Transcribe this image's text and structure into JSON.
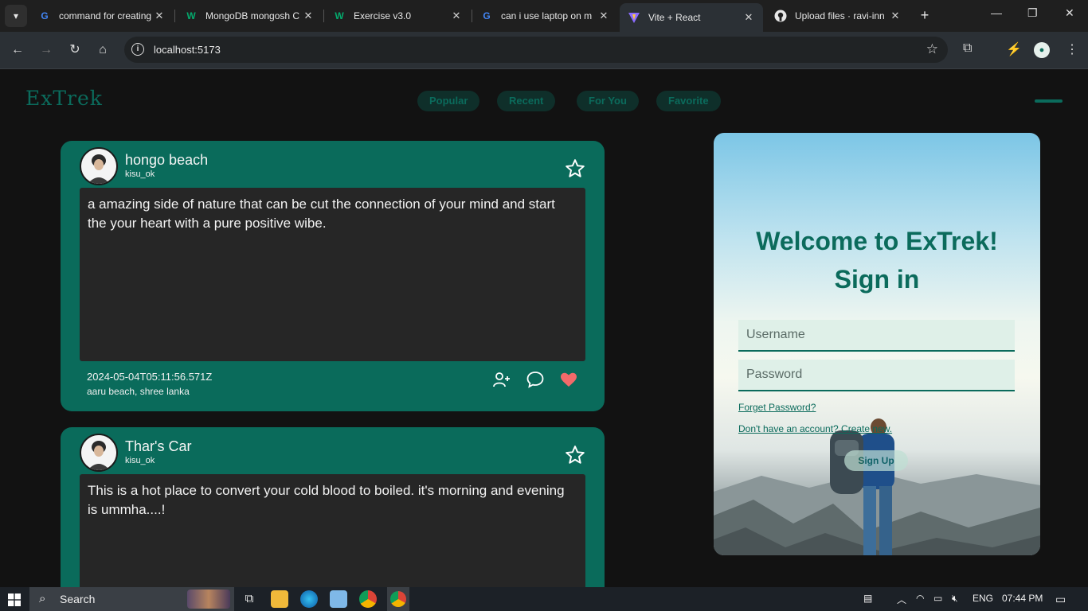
{
  "browser": {
    "tabs": [
      {
        "title": "command for creating",
        "favicon": "google-icon"
      },
      {
        "title": "MongoDB mongosh C",
        "favicon": "w3schools-icon"
      },
      {
        "title": "Exercise v3.0",
        "favicon": "w3schools-icon"
      },
      {
        "title": "can i use laptop on m",
        "favicon": "google-icon"
      },
      {
        "title": "Vite + React",
        "favicon": "vite-icon",
        "active": true
      },
      {
        "title": "Upload files · ravi-inn",
        "favicon": "github-icon"
      }
    ],
    "url": "localhost:5173"
  },
  "app": {
    "brand": "ExTrek",
    "nav": [
      "Popular",
      "Recent",
      "For You",
      "Favorite"
    ],
    "accent_color": "#0a6b5b",
    "posts": [
      {
        "title": "hongo beach",
        "user": "kisu_ok",
        "body": "a amazing side of nature that can be cut the connection of your mind and start the your heart with a pure positive wibe.",
        "date": "2024-05-04T05:11:56.571Z",
        "location": "aaru beach, shree lanka",
        "liked": true
      },
      {
        "title": "Thar's Car",
        "user": "kisu_ok",
        "body": "This is a hot place to convert your cold blood to boiled. it's morning and evening is ummha....!"
      }
    ],
    "login": {
      "heading_line1": "Welcome to ExTrek!",
      "heading_line2": "Sign in",
      "username_placeholder": "Username",
      "password_placeholder": "Password",
      "forgot_link": "Forget Password?",
      "create_link": "Don't have an account? Create new.",
      "signup_button": "Sign Up"
    }
  },
  "taskbar": {
    "search_placeholder": "Search",
    "language": "ENG",
    "time": "07:44 PM"
  }
}
